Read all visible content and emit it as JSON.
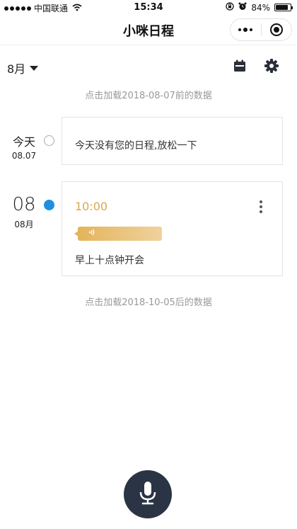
{
  "status_bar": {
    "carrier": "中国联通",
    "time": "15:34",
    "battery": "84%",
    "battery_level": 0.84,
    "wifi_icon": "wifi-icon",
    "lock_icon": "orientation-lock-icon",
    "alarm_icon": "alarm-icon"
  },
  "nav": {
    "title": "小咪日程",
    "more_icon": "more-dots-icon",
    "close_icon": "target-close-icon"
  },
  "toolbar": {
    "month": "8月",
    "calendar_icon": "calendar-icon",
    "settings_icon": "gear-icon"
  },
  "load_earlier": "点击加载2018-08-07前的数据",
  "days": [
    {
      "label": "今天",
      "date": "08.07",
      "empty_text": "今天没有您的日程,放松一下"
    },
    {
      "label": "08",
      "date": "08月",
      "events": [
        {
          "time": "10:00",
          "voice_icon": "voice-wave-icon",
          "note": "早上十点钟开会"
        }
      ]
    }
  ],
  "load_later": "点击加载2018-10-05后的数据",
  "mic_icon": "microphone-icon",
  "colors": {
    "accent_blue": "#1e8fe1",
    "gold": "#d9a84f",
    "mic_bg": "#2a3444",
    "muted_text": "#999999"
  }
}
